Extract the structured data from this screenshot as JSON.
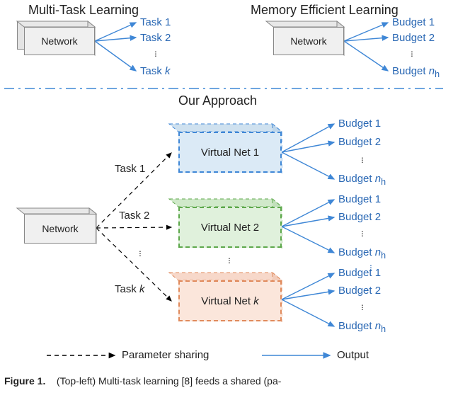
{
  "labels": {
    "network": "Network"
  },
  "top": {
    "mtl_title": "Multi-Task Learning",
    "mel_title": "Memory Efficient Learning",
    "mtl_outputs": [
      "Task 1",
      "Task 2",
      "Task",
      "k"
    ],
    "mel_outputs": [
      "Budget 1",
      "Budget 2",
      "Budget",
      "n",
      "h"
    ]
  },
  "ours": {
    "title": "Our Approach",
    "tasks": [
      "Task 1",
      "Task 2",
      "Task",
      "k"
    ],
    "vnets": [
      "Virtual Net 1",
      "Virtual Net 2",
      "Virtual Net",
      "k"
    ],
    "budgets": [
      "Budget 1",
      "Budget 2",
      "Budget",
      "n",
      "h"
    ]
  },
  "legend": {
    "param": "Parameter sharing",
    "output": "Output"
  },
  "caption": {
    "fig": "Figure 1.",
    "text": "(Top-left) Multi-task learning [8] feeds a shared (pa-"
  }
}
